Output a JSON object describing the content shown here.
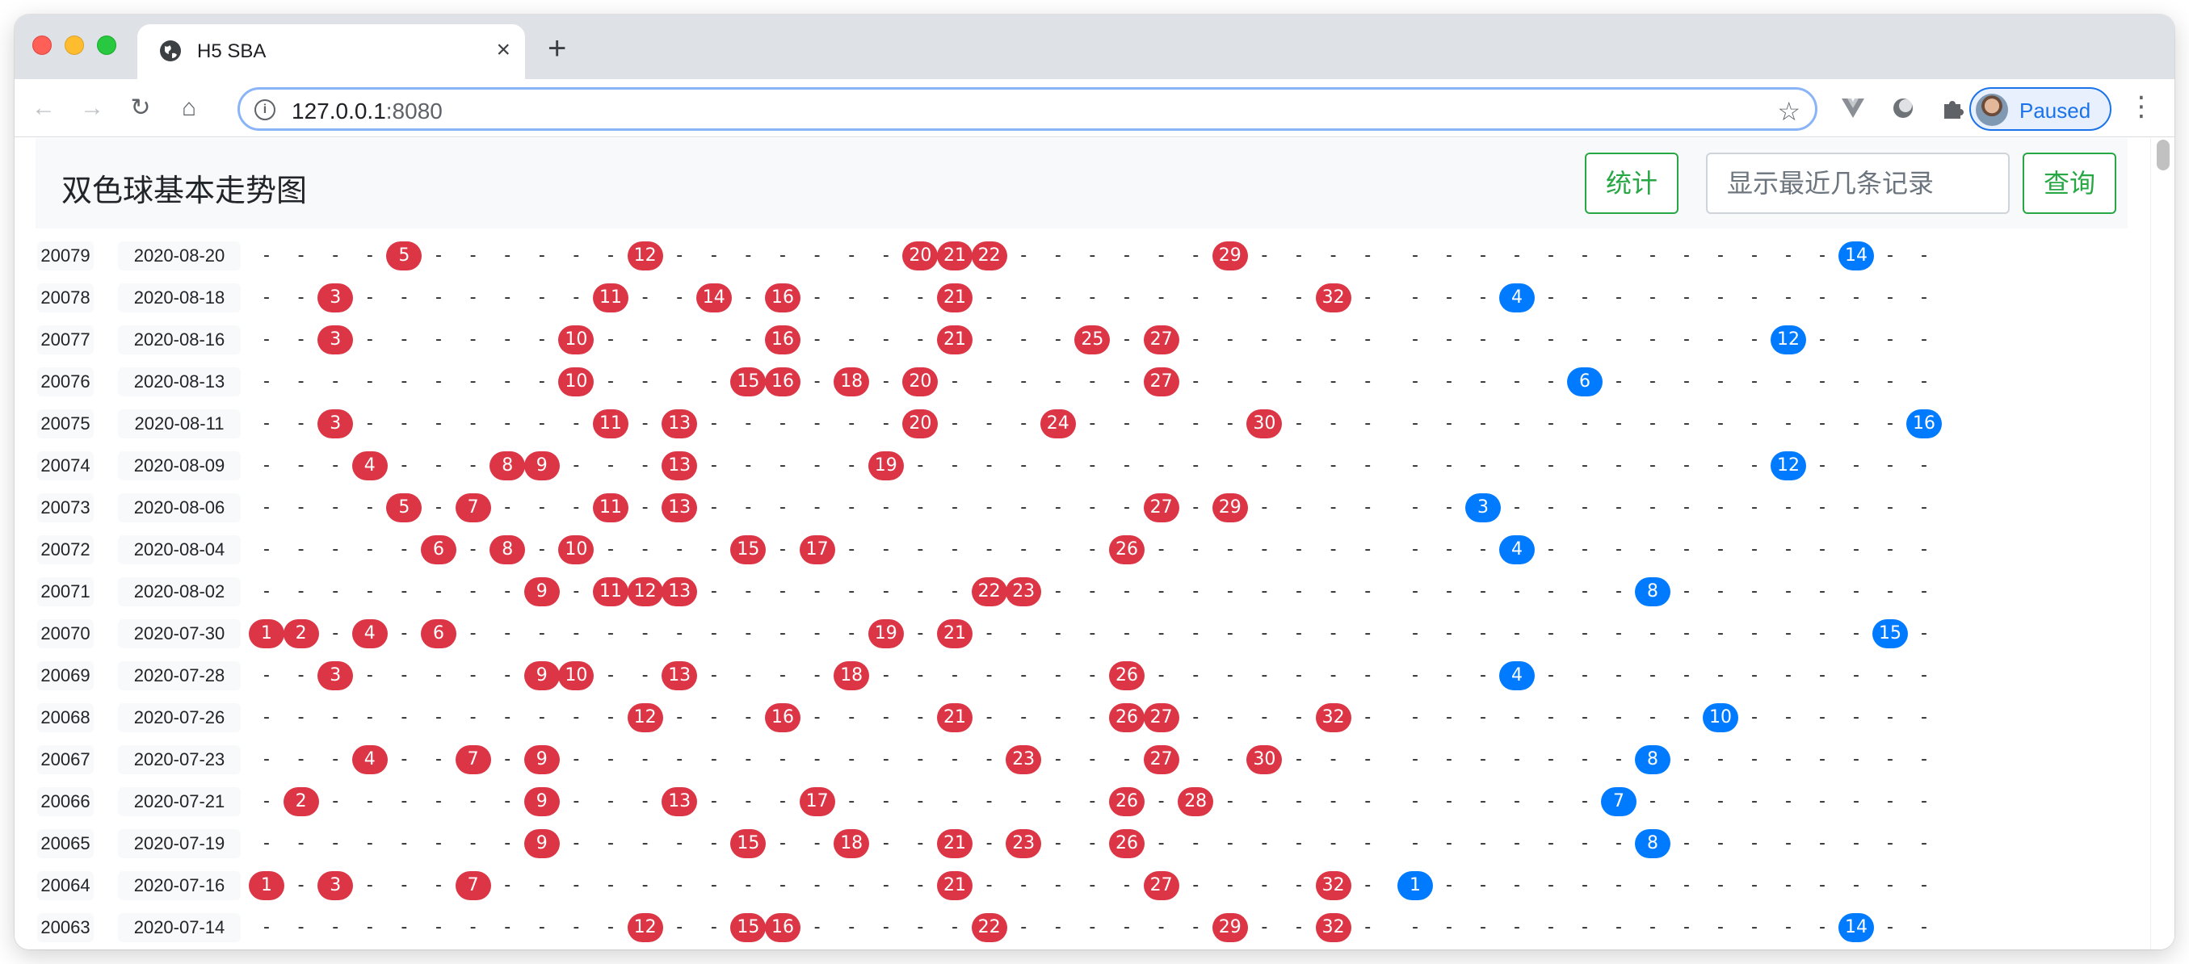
{
  "browser": {
    "tab_title": "H5 SBA",
    "new_tab_label": "+",
    "close_label": "×",
    "url_host": "127.0.0.1",
    "url_port": ":8080",
    "profile_label": "Paused",
    "accent_color": "#1a73e8"
  },
  "page": {
    "title": "双色球基本走势图",
    "stats_button": "统计",
    "search_placeholder": "显示最近几条记录",
    "query_button": "查询",
    "red_ball_color": "#dc3545",
    "blue_ball_color": "#007bff",
    "button_color": "#28a745"
  },
  "empty_marker": "-",
  "rows": [
    {
      "issue": "20079",
      "date": "2020-08-20",
      "red": [
        5,
        12,
        20,
        21,
        22,
        29
      ],
      "blue": 14
    },
    {
      "issue": "20078",
      "date": "2020-08-18",
      "red": [
        3,
        11,
        14,
        16,
        21,
        32
      ],
      "blue": 4
    },
    {
      "issue": "20077",
      "date": "2020-08-16",
      "red": [
        3,
        10,
        16,
        21,
        25,
        27
      ],
      "blue": 12
    },
    {
      "issue": "20076",
      "date": "2020-08-13",
      "red": [
        10,
        15,
        16,
        18,
        20,
        27
      ],
      "blue": 6
    },
    {
      "issue": "20075",
      "date": "2020-08-11",
      "red": [
        3,
        11,
        13,
        20,
        24,
        30
      ],
      "blue": 16
    },
    {
      "issue": "20074",
      "date": "2020-08-09",
      "red": [
        4,
        8,
        9,
        13,
        19
      ],
      "blue": 12
    },
    {
      "issue": "20073",
      "date": "2020-08-06",
      "red": [
        5,
        7,
        11,
        13,
        27,
        29
      ],
      "blue": 3
    },
    {
      "issue": "20072",
      "date": "2020-08-04",
      "red": [
        6,
        8,
        10,
        15,
        17,
        26
      ],
      "blue": 4
    },
    {
      "issue": "20071",
      "date": "2020-08-02",
      "red": [
        9,
        11,
        12,
        13,
        22,
        23
      ],
      "blue": 8
    },
    {
      "issue": "20070",
      "date": "2020-07-30",
      "red": [
        1,
        2,
        4,
        6,
        19,
        21
      ],
      "blue": 15
    },
    {
      "issue": "20069",
      "date": "2020-07-28",
      "red": [
        3,
        9,
        10,
        13,
        18,
        26
      ],
      "blue": 4
    },
    {
      "issue": "20068",
      "date": "2020-07-26",
      "red": [
        12,
        16,
        21,
        26,
        27,
        32
      ],
      "blue": 10
    },
    {
      "issue": "20067",
      "date": "2020-07-23",
      "red": [
        4,
        7,
        9,
        23,
        27,
        30
      ],
      "blue": 8
    },
    {
      "issue": "20066",
      "date": "2020-07-21",
      "red": [
        2,
        9,
        13,
        17,
        26,
        28
      ],
      "blue": 7
    },
    {
      "issue": "20065",
      "date": "2020-07-19",
      "red": [
        9,
        15,
        18,
        21,
        23,
        26
      ],
      "blue": 8
    },
    {
      "issue": "20064",
      "date": "2020-07-16",
      "red": [
        1,
        3,
        7,
        21,
        27,
        32
      ],
      "blue": 1
    },
    {
      "issue": "20063",
      "date": "2020-07-14",
      "red": [
        12,
        15,
        16,
        22,
        29,
        32
      ],
      "blue": 14
    }
  ]
}
